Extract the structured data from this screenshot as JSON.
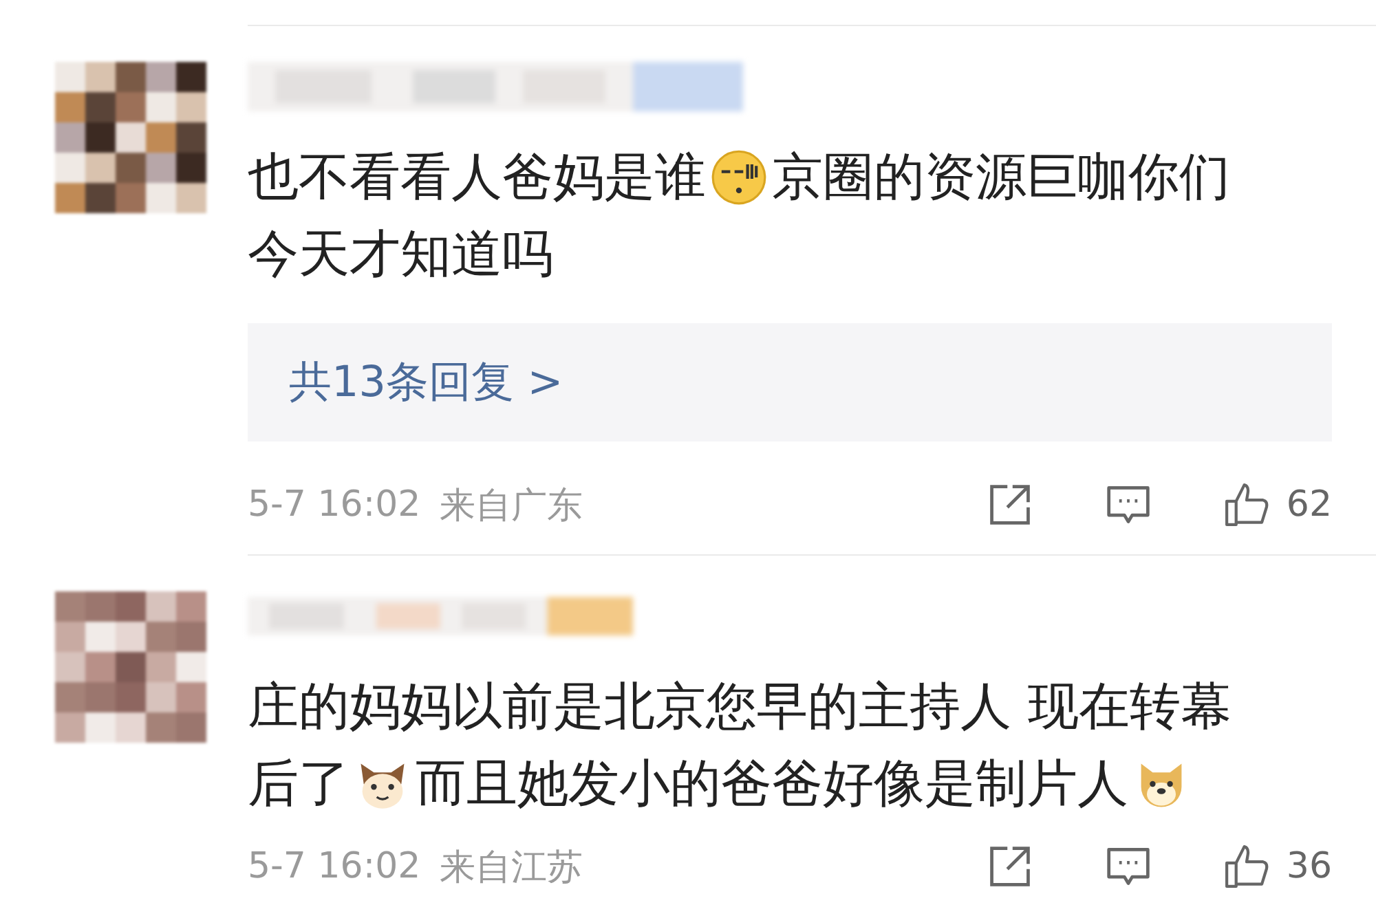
{
  "comments": [
    {
      "avatar": {
        "kind": "picture"
      },
      "lines": [
        [
          {
            "kind": "text",
            "text": "也不看看人爸妈是谁"
          },
          {
            "kind": "sleepy-emoji"
          },
          {
            "kind": "text",
            "text": "京圈的资源巨咖你们"
          }
        ],
        [
          {
            "kind": "text",
            "text": "今天才知道吗"
          }
        ]
      ],
      "replies": "共13条回复 >",
      "time": "5-7 16:02",
      "location": "来自广东",
      "likes": "62",
      "liked": false
    },
    {
      "avatar": {
        "kind": "picture"
      },
      "lines": [
        [
          {
            "kind": "text",
            "text": "庄的妈妈以前是北京您早的主持人 现在转幕"
          }
        ],
        [
          {
            "kind": "text",
            "text": "后了"
          },
          {
            "kind": "cat-emoji"
          },
          {
            "kind": "text",
            "text": "而且她发小的爸爸好像是制片人"
          },
          {
            "kind": "dog-emoji"
          }
        ]
      ],
      "time": "5-7 16:02",
      "location": "来自江苏",
      "likes": "36",
      "liked": false
    }
  ]
}
